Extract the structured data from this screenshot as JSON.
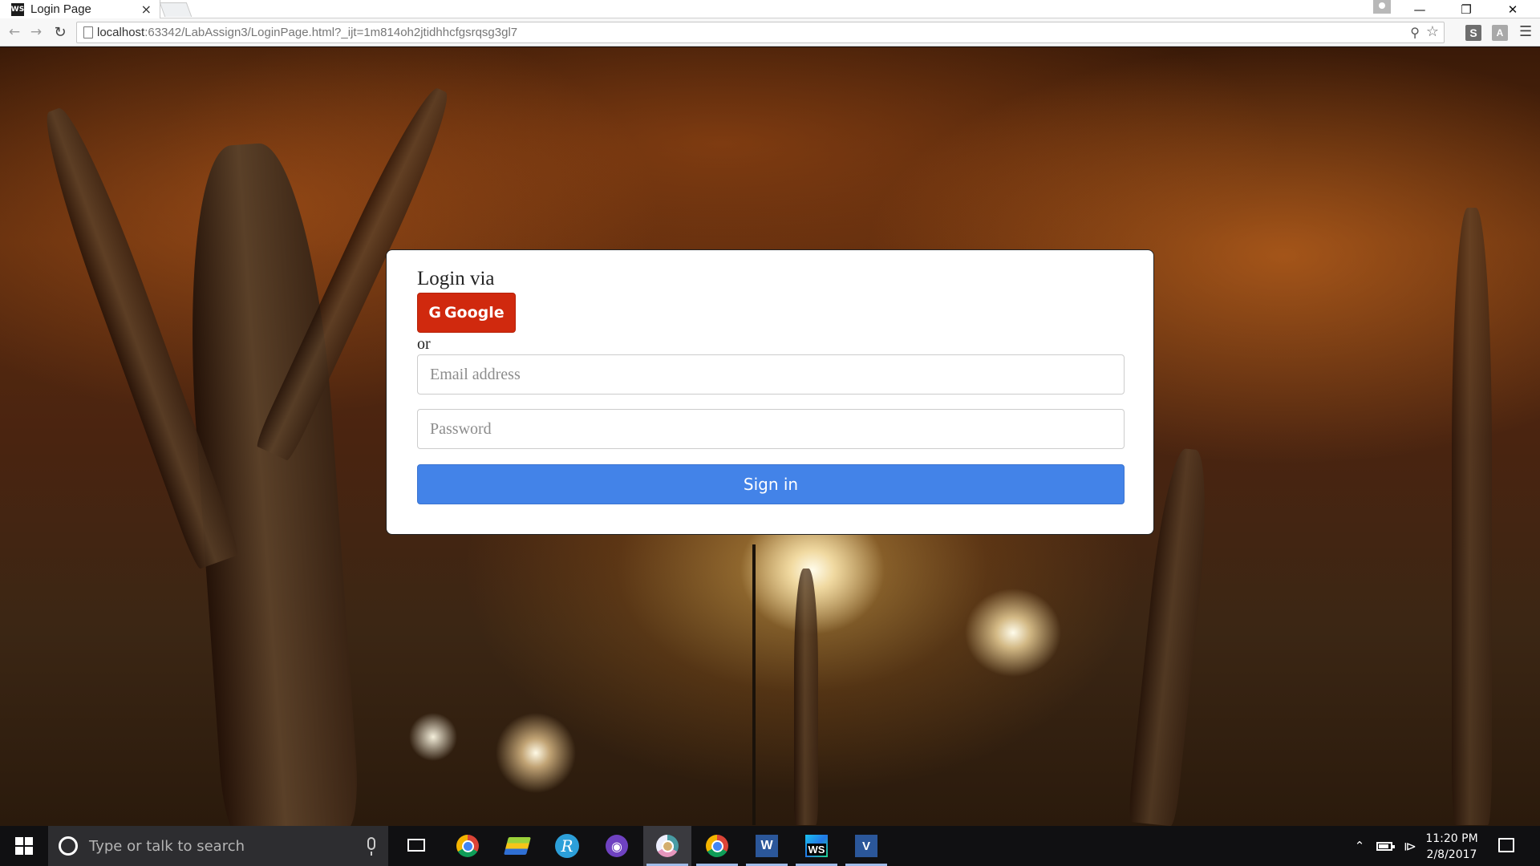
{
  "browser": {
    "tab_title": "Login Page",
    "tab_favicon_text": "WS",
    "tab_close_glyph": "×",
    "url_host": "localhost",
    "url_rest": ":63342/LabAssign3/LoginPage.html?_ijt=1m814oh2jtidhhcfgsrqsg3gl7",
    "extensions": [
      "S",
      "A"
    ],
    "icons": {
      "back": "arrow-left-icon",
      "forward": "arrow-right-icon",
      "reload": "reload-icon",
      "zoom": "zoom-icon",
      "bookmark": "star-icon",
      "menu": "hamburger-menu-icon"
    }
  },
  "login": {
    "heading": "Login via",
    "google_label": "Google",
    "google_icon_glyph": "G",
    "or_label": "or",
    "email_placeholder": "Email address",
    "password_placeholder": "Password",
    "signin_label": "Sign in",
    "colors": {
      "google": "#d0290e",
      "signin": "#4383e8"
    }
  },
  "taskbar": {
    "search_placeholder": "Type or talk to search",
    "apps": [
      "chrome",
      "stack",
      "r-studio",
      "github",
      "chrome-canary",
      "chrome",
      "word",
      "webstorm",
      "visual-studio"
    ],
    "word_label": "W",
    "webstorm_label": "WS",
    "vs_label": "V",
    "github_glyph": "◉",
    "r_label": "R",
    "clock_time": "11:20 PM",
    "clock_date": "2/8/2017"
  }
}
